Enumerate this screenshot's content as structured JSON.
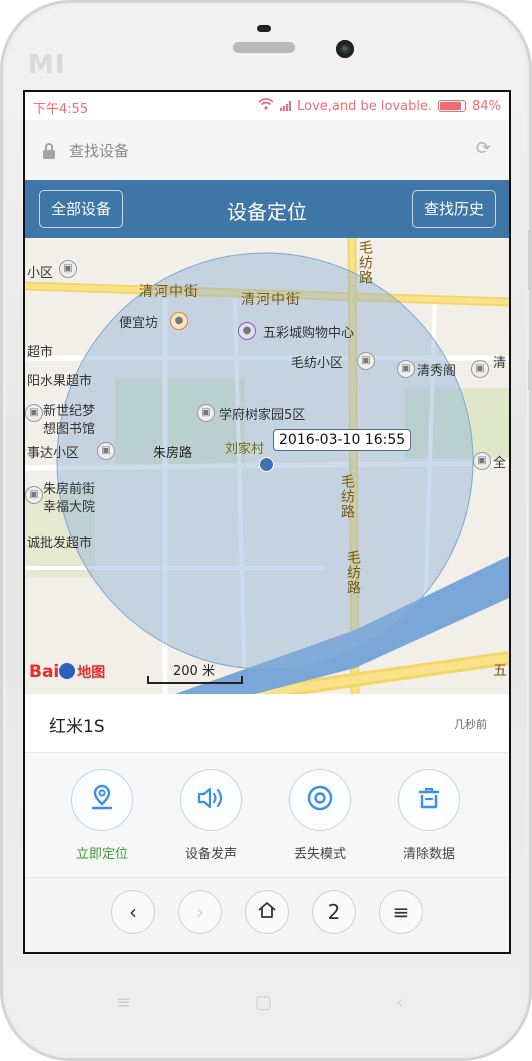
{
  "device_brand": "MI",
  "status_bar": {
    "time": "下午4:55",
    "carrier": "Love,and be lovable.",
    "battery": "84%"
  },
  "address_bar": {
    "text": "查找设备"
  },
  "header": {
    "left_button": "全部设备",
    "title": "设备定位",
    "right_button": "查找历史"
  },
  "map": {
    "labels": [
      "小区",
      "清河中街",
      "清河中街",
      "毛纺路",
      "超市",
      "便宜坊",
      "五彩城购物中心",
      "阳水果超市",
      "毛纺小区",
      "清秀阁",
      "清",
      "新世纪梦",
      "想图书馆",
      "学府树家园5区",
      "事达小区",
      "朱房路",
      "刘家村",
      "朱房前街",
      "幸福大院",
      "诚批发超市",
      "毛纺路",
      "毛纺路",
      "五",
      "全"
    ],
    "tooltip": "2016-03-10 16:55",
    "scale": "200 米",
    "logo_text": "Bai",
    "logo_text2": "地图"
  },
  "device": {
    "name": "红米1S",
    "time": "几秒前"
  },
  "actions": [
    {
      "label": "立即定位",
      "icon": "location-icon",
      "active": true
    },
    {
      "label": "设备发声",
      "icon": "speaker-icon",
      "active": false
    },
    {
      "label": "丢失模式",
      "icon": "target-icon",
      "active": false
    },
    {
      "label": "清除数据",
      "icon": "trash-icon",
      "active": false
    }
  ],
  "nav": {
    "tab_count": "2"
  },
  "colors": {
    "header": "#3d76a7",
    "accent": "#3a9a3a",
    "status": "#f26b72"
  }
}
